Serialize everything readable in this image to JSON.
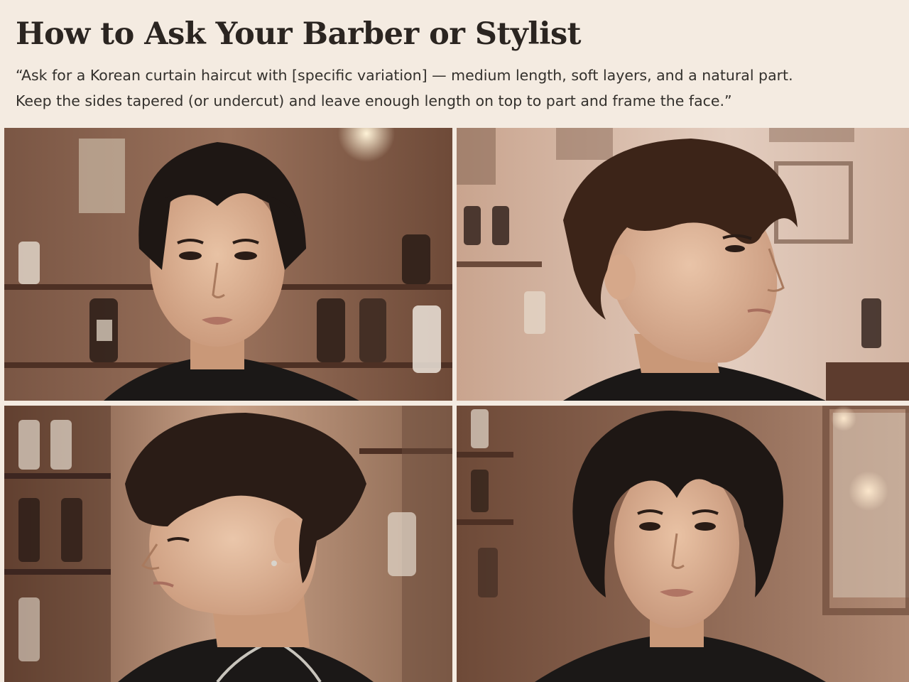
{
  "header": {
    "title": "How to Ask Your Barber or Stylist",
    "quote_line1": "“Ask for a Korean curtain haircut with [specific variation] — medium length, soft layers, and a natural part.",
    "quote_line2": "Keep the sides tapered (or undercut) and leave enough length on top to part and frame the face.”"
  },
  "colors": {
    "background": "#f4ebe1",
    "title_text": "#2b2521",
    "body_text": "#33302c"
  },
  "photos": [
    {
      "pose": "front",
      "hair": "dark brown curtain bangs, medium length"
    },
    {
      "pose": "three-quarter right profile",
      "hair": "brown curtain fringe with tapered undercut sides"
    },
    {
      "pose": "left profile",
      "hair": "dark textured curtain fringe with tapered sides, earring and chain"
    },
    {
      "pose": "front",
      "hair": "dark wavy medium-length curtain part"
    }
  ]
}
